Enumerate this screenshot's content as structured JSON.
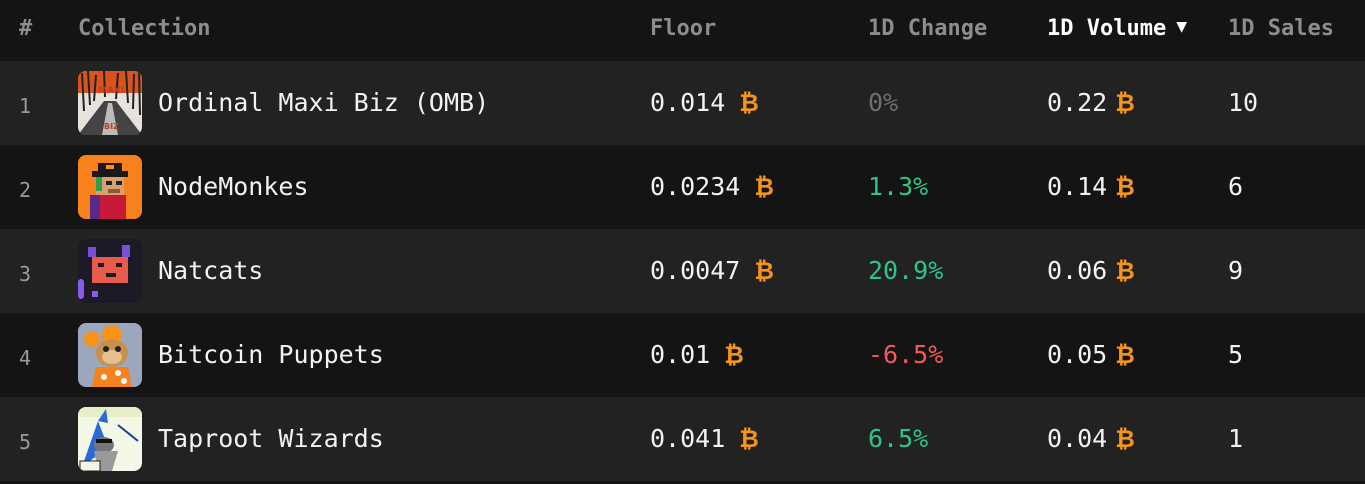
{
  "header": {
    "rank": "#",
    "collection": "Collection",
    "floor": "Floor",
    "change": "1D Change",
    "volume": "1D Volume",
    "volume_sort_icon": "▼",
    "sales": "1D Sales"
  },
  "currency_symbol": "₿",
  "colors": {
    "accent_btc": "#f7931a",
    "positive": "#2fc486",
    "negative": "#f25a5a",
    "neutral": "#6f6f6f"
  },
  "rows": [
    {
      "rank": "1",
      "name": "Ordinal Maxi Biz (OMB)",
      "floor": "0.014",
      "change": "0%",
      "change_state": "zero",
      "volume": "0.22",
      "sales": "10",
      "thumb_icon": "omb-thumbnail"
    },
    {
      "rank": "2",
      "name": "NodeMonkes",
      "floor": "0.0234",
      "change": "1.3%",
      "change_state": "pos",
      "volume": "0.14",
      "sales": "6",
      "thumb_icon": "nodemonkes-thumbnail"
    },
    {
      "rank": "3",
      "name": "Natcats",
      "floor": "0.0047",
      "change": "20.9%",
      "change_state": "pos",
      "volume": "0.06",
      "sales": "9",
      "thumb_icon": "natcats-thumbnail"
    },
    {
      "rank": "4",
      "name": "Bitcoin Puppets",
      "floor": "0.01",
      "change": "-6.5%",
      "change_state": "neg",
      "volume": "0.05",
      "sales": "5",
      "thumb_icon": "bitcoin-puppets-thumbnail"
    },
    {
      "rank": "5",
      "name": "Taproot Wizards",
      "floor": "0.041",
      "change": "6.5%",
      "change_state": "pos",
      "volume": "0.04",
      "sales": "1",
      "thumb_icon": "taproot-wizards-thumbnail"
    }
  ]
}
